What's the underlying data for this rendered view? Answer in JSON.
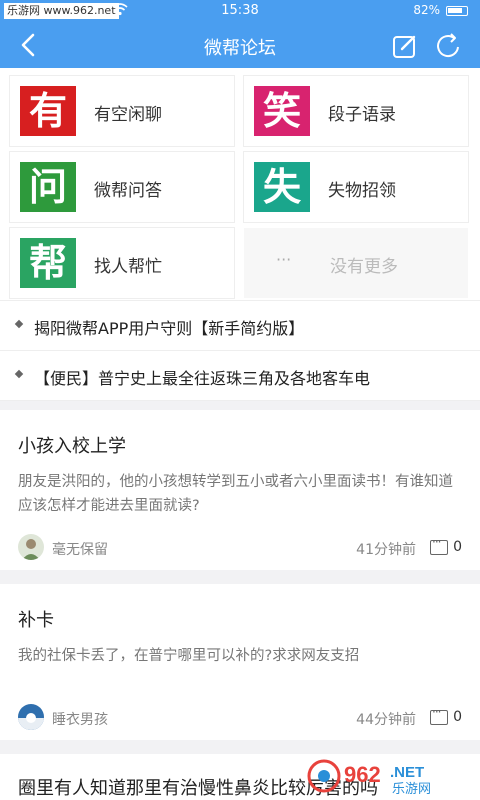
{
  "statusbar": {
    "watermark": "乐游网 www.962.net",
    "time": "15:38",
    "battery_pct": "82%"
  },
  "navbar": {
    "title": "微帮论坛"
  },
  "categories": [
    {
      "char": "有",
      "label": "有空闲聊",
      "color": "#d71f20"
    },
    {
      "char": "笑",
      "label": "段子语录",
      "color": "#d8236f"
    },
    {
      "char": "问",
      "label": "微帮问答",
      "color": "#2e9a3c"
    },
    {
      "char": "失",
      "label": "失物招领",
      "color": "#1aa68c"
    },
    {
      "char": "帮",
      "label": "找人帮忙",
      "color": "#2aa462"
    }
  ],
  "more_tile": {
    "dots": "···",
    "label": "没有更多"
  },
  "notices": [
    "揭阳微帮APP用户守则【新手简约版】",
    "【便民】普宁史上最全往返珠三角及各地客车电"
  ],
  "posts": [
    {
      "title": "小孩入校上学",
      "body": "朋友是洪阳的，他的小孩想转学到五小或者六小里面读书！有谁知道应该怎样才能进去里面就读?",
      "author": "毫无保留",
      "time": "41分钟前",
      "comments": "0"
    },
    {
      "title": "补卡",
      "body": "我的社保卡丢了，在普宁哪里可以补的?求求网友支招",
      "author": "睡衣男孩",
      "time": "44分钟前",
      "comments": "0"
    },
    {
      "title": "圈里有人知道那里有治慢性鼻炎比较厉害的吗"
    }
  ],
  "brand": {
    "logo_text": "962.NET",
    "logo_sub": "乐游网"
  }
}
